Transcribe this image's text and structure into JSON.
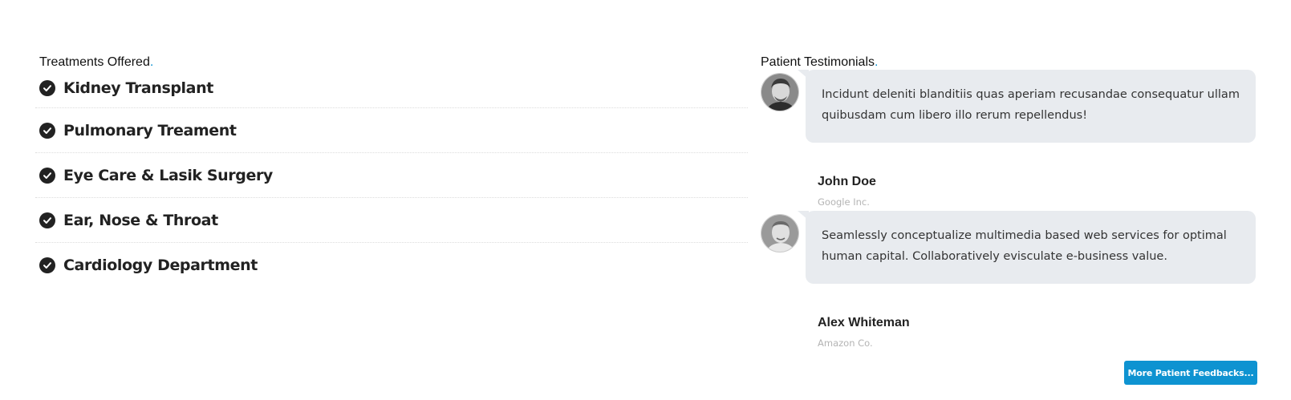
{
  "treatments": {
    "title": "Treatments Offered",
    "items": [
      {
        "label": "Kidney Transplant"
      },
      {
        "label": "Pulmonary Treament"
      },
      {
        "label": "Eye Care & Lasik Surgery"
      },
      {
        "label": "Ear, Nose & Throat"
      },
      {
        "label": "Cardiology Department"
      }
    ],
    "icon": "check-circle-icon"
  },
  "testimonials": {
    "title": "Patient Testimonials",
    "items": [
      {
        "quote": "Incidunt deleniti blanditiis quas aperiam recusandae consequatur ullam quibusdam cum libero illo rerum repellendus!",
        "name": "John Doe",
        "company": "Google Inc."
      },
      {
        "quote": "Seamlessly conceptualize multimedia based web services for optimal human capital. Collaboratively evisculate e-business value.",
        "name": "Alex Whiteman",
        "company": "Amazon Co."
      }
    ],
    "more_button": "More Patient Feedbacks..."
  },
  "colors": {
    "accent": "#0e93d1",
    "bubble": "#e8ebef",
    "text": "#222222",
    "muted": "#b4b4b4"
  }
}
